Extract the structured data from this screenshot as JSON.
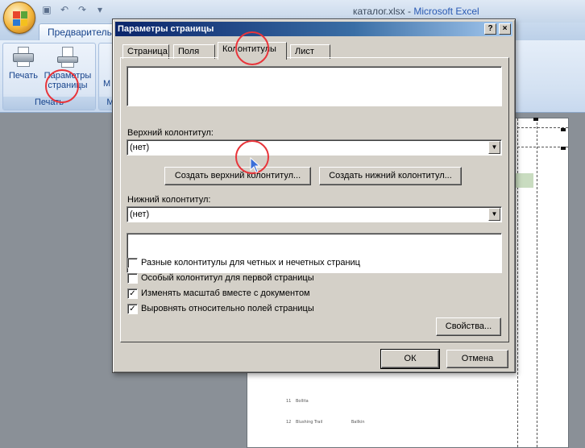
{
  "titlebar": {
    "document": "каталог.xlsx",
    "separator": " - ",
    "app": "Microsoft Excel",
    "qat_icons": [
      "save-icon",
      "undo-icon",
      "redo-icon",
      "customize-icon"
    ]
  },
  "ribbon": {
    "tab_label": "Предварительн",
    "groups": [
      {
        "label": "Печать",
        "buttons": [
          {
            "label": "Печать",
            "icon": "printer-icon"
          },
          {
            "label_line1": "Параметры",
            "label_line2": "страницы",
            "icon": "page-setup-icon"
          }
        ]
      },
      {
        "label": "М",
        "buttons": [
          {
            "label": "М"
          }
        ]
      }
    ]
  },
  "dialog": {
    "title": "Параметры страницы",
    "help_button": "?",
    "close_button": "×",
    "tabs": [
      {
        "label": "Страница",
        "active": false
      },
      {
        "label": "Поля",
        "active": false
      },
      {
        "label": "Колонтитулы",
        "active": true
      },
      {
        "label": "Лист",
        "active": false
      }
    ],
    "header_label": "Верхний колонтитул:",
    "header_value": "(нет)",
    "create_header_button": "Создать верхний колонтитул...",
    "create_footer_button": "Создать нижний колонтитул...",
    "footer_label": "Нижний колонтитул:",
    "footer_value": "(нет)",
    "options": [
      {
        "label": "Разные колонтитулы для четных и нечетных страниц",
        "checked": false
      },
      {
        "label": "Особый колонтитул для первой страницы",
        "checked": false
      },
      {
        "label": "Изменять масштаб вместе с документом",
        "checked": true
      },
      {
        "label": "Выровнять относительно полей страницы",
        "checked": true
      }
    ],
    "properties_button": "Свойства...",
    "ok_button": "ОК",
    "cancel_button": "Отмена"
  },
  "sheet_preview": {
    "rows": [
      {
        "num": "11",
        "name": "Bollita"
      },
      {
        "num": "12",
        "name": "Blushing Trail",
        "extra": "Ballkin"
      }
    ]
  }
}
